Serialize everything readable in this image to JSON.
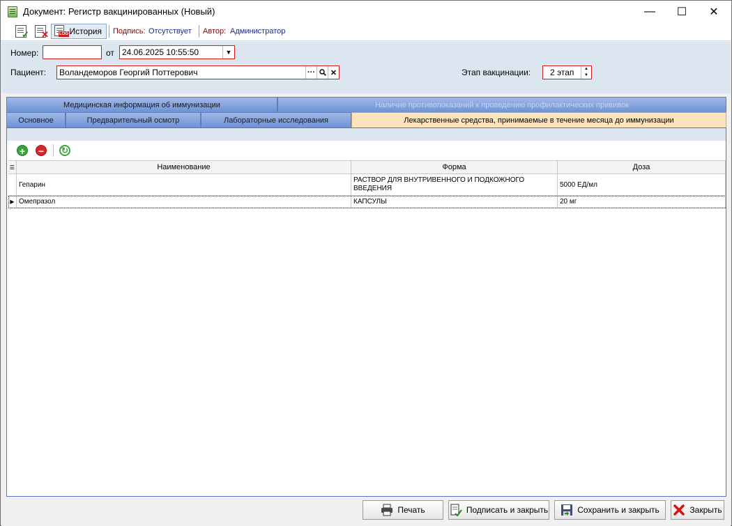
{
  "window": {
    "title": "Документ: Регистр вакцинированных (Новый)",
    "minimize": "—",
    "maximize": "☐",
    "close": "✕"
  },
  "toolbar": {
    "history_label": "История",
    "log_badge": "LOG",
    "signature_label": "Подпись:",
    "signature_value": "Отсутствует",
    "author_label": "Автор:",
    "author_value": "Администратор"
  },
  "form": {
    "number_label": "Номер:",
    "number_value": "",
    "from_label": "от",
    "date_value": "24.06.2025 10:55:50",
    "patient_label": "Пациент:",
    "patient_value": "Воландеморов Георгий Поттерович",
    "stage_label": "Этап вакцинации:",
    "stage_value": "2 этап"
  },
  "tabs_top": [
    {
      "label": "Медицинская информация об иммунизации",
      "enabled": true
    },
    {
      "label": "Наличие противопоказаний к проведению профилактических прививок",
      "enabled": false
    }
  ],
  "tabs_bottom": [
    {
      "label": "Основное"
    },
    {
      "label": "Предварительный осмотр"
    },
    {
      "label": "Лабораторные исследования"
    },
    {
      "label": "Лекарственные средства, принимаемые в течение месяца до иммунизации",
      "active": true
    }
  ],
  "grid": {
    "columns": [
      "Наименование",
      "Форма",
      "Доза"
    ],
    "rows": [
      {
        "name": "Гепарин",
        "form": "РАСТВОР ДЛЯ ВНУТРИВЕННОГО И ПОДКОЖНОГО ВВЕДЕНИЯ",
        "dose": "5000 ЕД/мл"
      },
      {
        "name": "Омепразол",
        "form": "КАПСУЛЫ",
        "dose": "20 мг"
      }
    ]
  },
  "buttons": {
    "print": "Печать",
    "sign_close": "Подписать и закрыть",
    "save_close": "Сохранить и закрыть",
    "close": "Закрыть"
  },
  "colors": {
    "tab_active": "#fde4bc",
    "tab_inactive": "#7b9bd9",
    "header_bg": "#dbe6f1",
    "required_border": "#d21c1c"
  }
}
